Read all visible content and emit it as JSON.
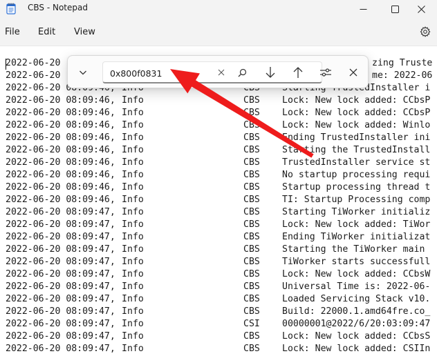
{
  "window": {
    "title": "CBS - Notepad"
  },
  "menu": {
    "file": "File",
    "edit": "Edit",
    "view": "View"
  },
  "find": {
    "query": "0x800f0831"
  },
  "icons": {
    "app": "notepad-icon",
    "minimize": "minimize-icon",
    "maximize": "maximize-icon",
    "close": "close-icon",
    "settings": "gear-icon",
    "expand": "chevron-down-icon",
    "clear": "clear-icon",
    "search": "search-icon",
    "next": "arrow-down-icon",
    "previous": "arrow-up-icon",
    "options": "options-icon",
    "close_find": "close-find-icon"
  },
  "colors": {
    "annotation_arrow": "#ee1c1c"
  },
  "lines": [
    {
      "date": "2022-06-20 ",
      "level": "",
      "src": "",
      "msg": ""
    },
    {
      "date": "2022-06-20 ",
      "level": "",
      "src": "",
      "msg": ""
    },
    {
      "date": "2022-06-20 08:09:46,",
      "level": "Info",
      "src": "CBS",
      "msg": "Starting TrustedInstaller i"
    },
    {
      "date": "2022-06-20 08:09:46,",
      "level": "Info",
      "src": "CBS",
      "msg": "Lock: New lock added: CCbsP"
    },
    {
      "date": "2022-06-20 08:09:46,",
      "level": "Info",
      "src": "CBS",
      "msg": "Lock: New lock added: CCbsP"
    },
    {
      "date": "2022-06-20 08:09:46,",
      "level": "Info",
      "src": "CBS",
      "msg": "Lock: New lock added: Winlo"
    },
    {
      "date": "2022-06-20 08:09:46,",
      "level": "Info",
      "src": "CBS",
      "msg": "Ending TrustedInstaller ini"
    },
    {
      "date": "2022-06-20 08:09:46,",
      "level": "Info",
      "src": "CBS",
      "msg": "Starting the TrustedInstall"
    },
    {
      "date": "2022-06-20 08:09:46,",
      "level": "Info",
      "src": "CBS",
      "msg": "TrustedInstaller service st"
    },
    {
      "date": "2022-06-20 08:09:46,",
      "level": "Info",
      "src": "CBS",
      "msg": "No startup processing requi"
    },
    {
      "date": "2022-06-20 08:09:46,",
      "level": "Info",
      "src": "CBS",
      "msg": "Startup processing thread t"
    },
    {
      "date": "2022-06-20 08:09:46,",
      "level": "Info",
      "src": "CBS",
      "msg": "TI: Startup Processing comp"
    },
    {
      "date": "2022-06-20 08:09:47,",
      "level": "Info",
      "src": "CBS",
      "msg": "Starting TiWorker initializ"
    },
    {
      "date": "2022-06-20 08:09:47,",
      "level": "Info",
      "src": "CBS",
      "msg": "Lock: New lock added: TiWor"
    },
    {
      "date": "2022-06-20 08:09:47,",
      "level": "Info",
      "src": "CBS",
      "msg": "Ending TiWorker initializat"
    },
    {
      "date": "2022-06-20 08:09:47,",
      "level": "Info",
      "src": "CBS",
      "msg": "Starting the TiWorker main"
    },
    {
      "date": "2022-06-20 08:09:47,",
      "level": "Info",
      "src": "CBS",
      "msg": "TiWorker starts successfull"
    },
    {
      "date": "2022-06-20 08:09:47,",
      "level": "Info",
      "src": "CBS",
      "msg": "Lock: New lock added: CCbsW"
    },
    {
      "date": "2022-06-20 08:09:47,",
      "level": "Info",
      "src": "CBS",
      "msg": "Universal Time is: 2022-06-"
    },
    {
      "date": "2022-06-20 08:09:47,",
      "level": "Info",
      "src": "CBS",
      "msg": "Loaded Servicing Stack v10."
    },
    {
      "date": "2022-06-20 08:09:47,",
      "level": "Info",
      "src": "CBS",
      "msg": "Build: 22000.1.amd64fre.co_"
    },
    {
      "date": "2022-06-20 08:09:47,",
      "level": "Info",
      "src": "CSI",
      "msg": "00000001@2022/6/20:03:09:47"
    },
    {
      "date": "2022-06-20 08:09:47,",
      "level": "Info",
      "src": "CBS",
      "msg": "Lock: New lock added: CCbsS"
    },
    {
      "date": "2022-06-20 08:09:47,",
      "level": "Info",
      "src": "CBS",
      "msg": "Lock: New lock added: CSIIn"
    }
  ],
  "partial": {
    "line0_tail": "zing Truste",
    "line1_tail": "me: 2022-06"
  }
}
